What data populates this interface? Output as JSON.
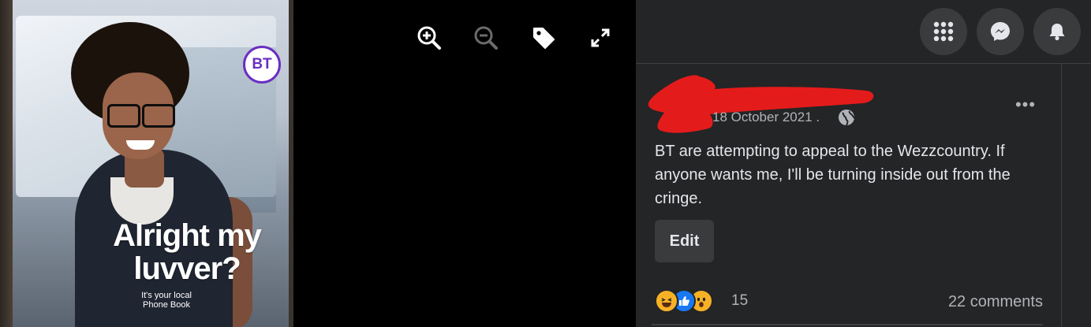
{
  "photo": {
    "brand_logo": "BT",
    "headline": "Alright my luvver?",
    "tagline": "It's your local Phone Book"
  },
  "viewer_toolbar": {
    "icons": [
      "zoom-in-icon",
      "zoom-out-icon",
      "tag-icon",
      "fullscreen-icon"
    ]
  },
  "topbar": {
    "icons": [
      "menu-grid-icon",
      "messenger-icon",
      "notifications-icon"
    ]
  },
  "post": {
    "author": "[redacted]",
    "date": "18 October 2021 .",
    "privacy_icon": "globe-icon",
    "menu_label": "•••",
    "text": "BT are attempting to appeal to the Wezzcountry. If anyone wants me, I'll be turning inside out from the cringe.",
    "edit_label": "Edit",
    "reactions": [
      "haha",
      "like",
      "wow"
    ],
    "reaction_count": "15",
    "comments_label": "22 comments"
  },
  "colors": {
    "panel_bg": "#242526",
    "button_bg": "#3a3b3c",
    "text_primary": "#e4e6eb",
    "text_secondary": "#b0b3b8",
    "redaction": "#e41b1b",
    "bt_purple": "#6a2ec2"
  }
}
